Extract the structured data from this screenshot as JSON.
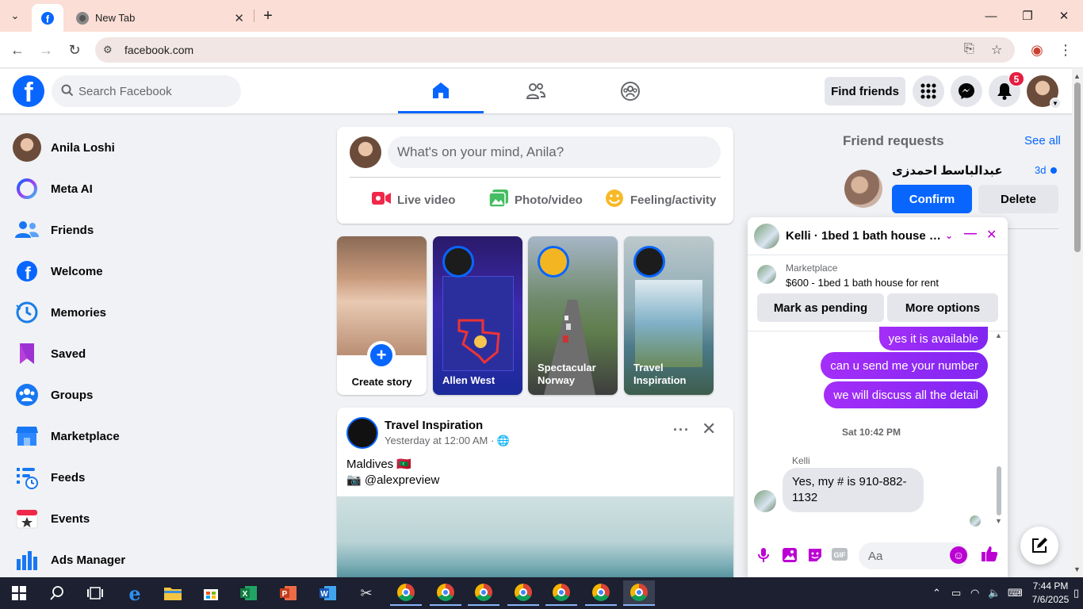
{
  "browser": {
    "tab_active_icon": "facebook-icon",
    "tab_newtab_label": "New Tab",
    "url": "facebook.com"
  },
  "fb_nav": {
    "logo": "f",
    "search_placeholder": "Search Facebook",
    "find_friends": "Find friends",
    "notifications_count": "5"
  },
  "sidebar": {
    "items": [
      {
        "label": "Anila Loshi",
        "icon": "profile-avatar"
      },
      {
        "label": "Meta AI",
        "icon": "meta-ai-icon"
      },
      {
        "label": "Friends",
        "icon": "friends-icon"
      },
      {
        "label": "Welcome",
        "icon": "facebook-icon"
      },
      {
        "label": "Memories",
        "icon": "memories-icon"
      },
      {
        "label": "Saved",
        "icon": "saved-icon"
      },
      {
        "label": "Groups",
        "icon": "groups-icon"
      },
      {
        "label": "Marketplace",
        "icon": "marketplace-icon"
      },
      {
        "label": "Feeds",
        "icon": "feeds-icon"
      },
      {
        "label": "Events",
        "icon": "events-icon"
      },
      {
        "label": "Ads Manager",
        "icon": "ads-manager-icon"
      }
    ]
  },
  "composer": {
    "placeholder": "What's on your mind, Anila?",
    "live_video": "Live video",
    "photo_video": "Photo/video",
    "feeling": "Feeling/activity"
  },
  "stories": {
    "create": "Create story",
    "items": [
      {
        "label": "Allen West"
      },
      {
        "label": "Spectacular Norway"
      },
      {
        "label": "Travel Inspiration"
      }
    ]
  },
  "post": {
    "author": "Travel Inspiration",
    "time": "Yesterday at 12:00 AM · ",
    "line1": "Maldives 🇲🇻",
    "line2": "📷 @alexpreview"
  },
  "friend_requests": {
    "title": "Friend requests",
    "see_all": "See all",
    "name": "عبدالباسط احمدزی",
    "time": "3d",
    "confirm": "Confirm",
    "delete": "Delete"
  },
  "chat": {
    "title": "Kelli · 1bed 1 bath house fo...",
    "marketplace_label": "Marketplace",
    "listing": "$600 - 1bed 1 bath house for rent",
    "mark_pending": "Mark as pending",
    "more_options": "More options",
    "messages_out": [
      "yes it is available",
      "can u send me your number",
      "we will discuss all the detail"
    ],
    "date": "Sat 10:42 PM",
    "sender": "Kelli",
    "message_in": "Yes, my # is 910-882-1132",
    "input_placeholder": "Aa"
  },
  "taskbar": {
    "time": "7:44 PM",
    "date": "7/6/2025"
  },
  "colors": {
    "fb_blue": "#0866ff",
    "messenger_purple": "#bc00d4",
    "tab_bar": "#fbded6"
  }
}
